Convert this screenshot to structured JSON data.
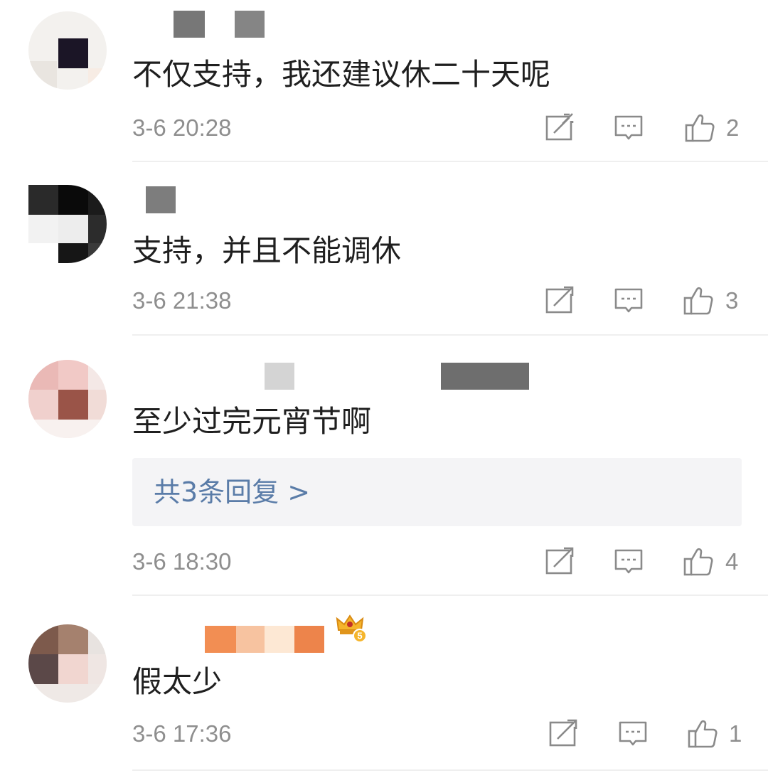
{
  "comments": [
    {
      "text": "不仅支持，我还建议休二十天呢",
      "time": "3-6 20:28",
      "likes": "2"
    },
    {
      "text": "支持，并且不能调休",
      "time": "3-6 21:38",
      "likes": "3"
    },
    {
      "text": "至少过完元宵节啊",
      "time": "3-6 18:30",
      "likes": "4",
      "replies_label": "共3条回复 >"
    },
    {
      "text": "假太少",
      "time": "3-6 17:36",
      "likes": "1",
      "badge": "crown-level-5",
      "badge_level": "5"
    }
  ],
  "icons": {
    "share": "share-icon",
    "reply": "comment-icon",
    "like": "thumbs-up-icon"
  },
  "colors": {
    "text": "#1f1f1f",
    "meta": "#8e8e8e",
    "link": "#5a7ca8",
    "reply_bg": "#f4f4f6"
  }
}
